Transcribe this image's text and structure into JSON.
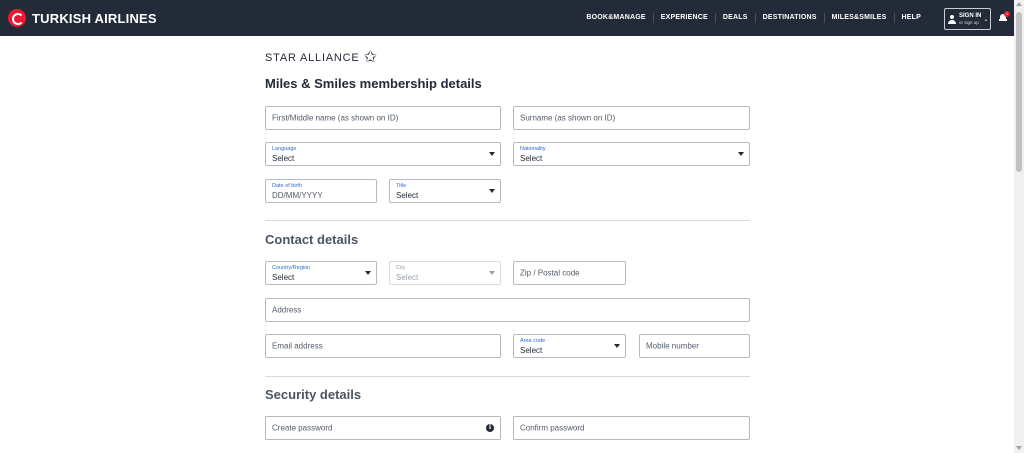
{
  "header": {
    "brand": "TURKISH AIRLINES",
    "nav": [
      "BOOK&MANAGE",
      "EXPERIENCE",
      "DEALS",
      "DESTINATIONS",
      "MILES&SMILES",
      "HELP"
    ],
    "signin_label": "SIGN IN",
    "signin_sub": "or sign up",
    "notification_count": "1",
    "brand_color": "#e81932",
    "header_bg": "#232b38"
  },
  "alliance": {
    "label": "STAR ALLIANCE"
  },
  "membership": {
    "title": "Miles & Smiles membership details",
    "first_name_placeholder": "First/Middle name (as shown on ID)",
    "surname_placeholder": "Surname (as shown on ID)",
    "language_label": "Language",
    "language_value": "Select",
    "nationality_label": "Nationality",
    "nationality_value": "Select",
    "dob_label": "Date of birth",
    "dob_placeholder": "DD/MM/YYYY",
    "title_label": "Title",
    "title_value": "Select"
  },
  "contact": {
    "title": "Contact details",
    "country_label": "Country/Region",
    "country_value": "Select",
    "city_label": "City",
    "city_value": "Select",
    "zip_placeholder": "Zip / Postal code",
    "address_placeholder": "Address",
    "email_placeholder": "Email address",
    "area_code_label": "Area code",
    "area_code_value": "Select",
    "mobile_placeholder": "Mobile number"
  },
  "security": {
    "title": "Security details",
    "create_password_placeholder": "Create password",
    "confirm_password_placeholder": "Confirm password"
  }
}
